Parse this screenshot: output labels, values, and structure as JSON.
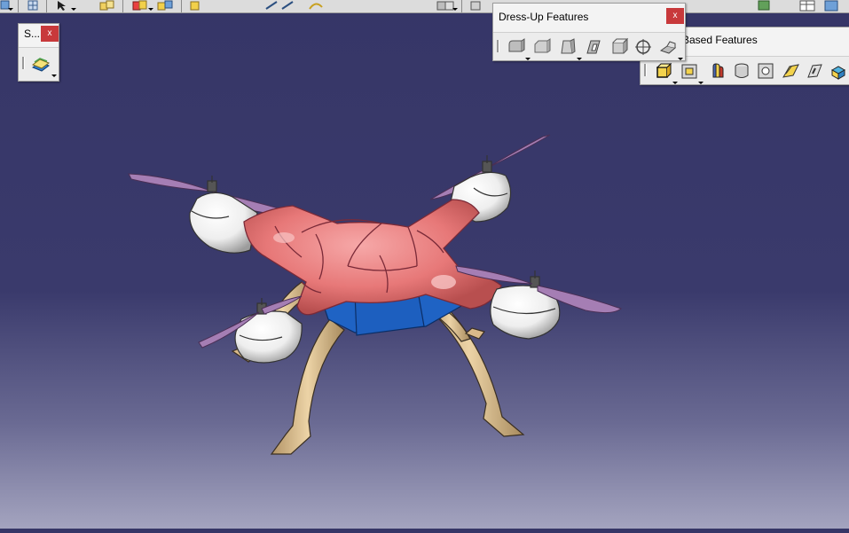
{
  "app": {
    "colors": {
      "bg_top": "#363667",
      "bg_bottom": "#a4a4bf",
      "body_shell": "#e97a7a",
      "body_blue": "#1f63c4",
      "motor_white": "#f2f2f2",
      "propeller": "#a57eb4",
      "landing_gear": "#d9b98a",
      "close_button": "#c8393b"
    }
  },
  "sketch_toolbar": {
    "title": "S...",
    "close_label": "x",
    "buttons": [
      {
        "icon": "sketch-plane-icon"
      }
    ]
  },
  "dressup_toolbar": {
    "title": "Dress-Up Features",
    "close_label": "x",
    "buttons": [
      {
        "icon": "fillet-icon"
      },
      {
        "icon": "chamfer-icon"
      },
      {
        "icon": "draft-icon"
      },
      {
        "icon": "shell-icon"
      },
      {
        "icon": "thickness-icon"
      },
      {
        "icon": "thread-icon"
      },
      {
        "icon": "remove-face-icon"
      }
    ]
  },
  "sketch_based_toolbar": {
    "title": "Based Features",
    "buttons": [
      {
        "icon": "pad-icon"
      },
      {
        "icon": "pocket-icon"
      },
      {
        "icon": "shaft-icon"
      },
      {
        "icon": "groove-icon"
      },
      {
        "icon": "hole-icon"
      },
      {
        "icon": "rib-icon"
      },
      {
        "icon": "slot-icon"
      },
      {
        "icon": "solid-combine-icon"
      }
    ]
  },
  "viewport": {
    "model": "quadcopter-drone"
  }
}
